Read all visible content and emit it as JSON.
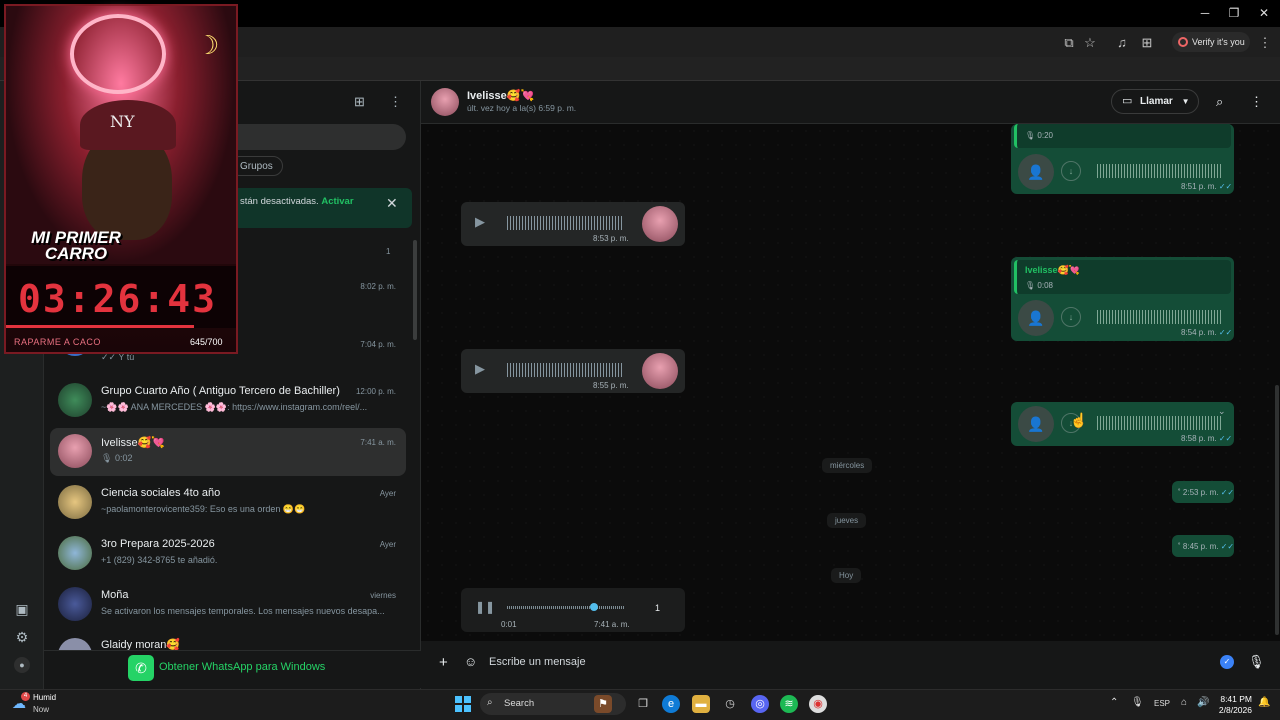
{
  "browser": {
    "verify_label": "Verify it's you"
  },
  "sidebar": {
    "filter_groups": "Grupos",
    "notification": {
      "text": "stán desactivadas. ",
      "link": "Activar"
    },
    "unread_count": "1",
    "chats": [
      {
        "time": "8:02 p. m."
      },
      {
        "preview": "✓✓ Y tú",
        "time": "7:04 p. m."
      },
      {
        "name": "Grupo Cuarto Año ( Antiguo Tercero de Bachiller)",
        "time": "12:00 p. m.",
        "preview": "~🌸🌸 ANA MERCEDES 🌸🌸: https://www.instagram.com/reel/..."
      },
      {
        "name": "Ivelisse🥰💘",
        "time": "7:41 a. m.",
        "preview": "0:02"
      },
      {
        "name": "Ciencia sociales 4to año",
        "time": "Ayer",
        "preview": "~paolamonterovicente359: Eso es una orden 😁😁"
      },
      {
        "name": "3ro Prepara 2025-2026",
        "time": "Ayer",
        "preview": "+1 (829) 342-8765 te añadió."
      },
      {
        "name": "Moña",
        "time": "viernes",
        "preview": "Se activaron los mensajes temporales. Los mensajes nuevos desapa..."
      },
      {
        "name": "Glaidy moran🥰"
      }
    ],
    "get_whatsapp": "Obtener WhatsApp para Windows"
  },
  "chat": {
    "name": "Ivelisse🥰💘",
    "status": "últ. vez hoy a la(s) 6:59 p. m.",
    "call_label": "Llamar",
    "messages": [
      {
        "dir": "out",
        "quote_duration": "0:20",
        "time": "8:51 p. m."
      },
      {
        "dir": "in",
        "time": "8:53 p. m."
      },
      {
        "dir": "out",
        "quote_name": "Ivelisse🥰💘",
        "quote_duration": "0:08",
        "time": "8:54 p. m."
      },
      {
        "dir": "in",
        "time": "8:55 p. m."
      },
      {
        "dir": "out",
        "time": "8:58 p. m."
      },
      {
        "dir": "out",
        "time": "2:53 p. m."
      },
      {
        "dir": "out",
        "time": "8:45 p. m."
      }
    ],
    "day_labels": [
      "miércoles",
      "jueves",
      "Hoy"
    ],
    "player": {
      "elapsed": "0:01",
      "time": "7:41 a. m.",
      "speed": "1",
      "progress": 0.74
    },
    "composer_placeholder": "Escribe un mensaje"
  },
  "overlay": {
    "caption": "MI PRIMER CARRO",
    "timer": "03:26:43",
    "label": "RAPARME A CACO",
    "count": "645/700",
    "progress": 0.92
  },
  "taskbar": {
    "weather_title": "Humid",
    "weather_sub": "Now",
    "weather_badge": "4",
    "search_label": "Search",
    "lang": "ESP",
    "time": "8:41 PM",
    "date": "2/8/2026"
  }
}
